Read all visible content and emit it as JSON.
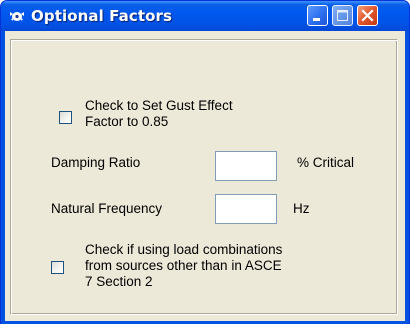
{
  "window": {
    "title": "Optional Factors",
    "icon": "app-icon",
    "controls": {
      "minimize": "minimize-icon",
      "maximize": "maximize-icon",
      "close": "close-icon"
    }
  },
  "form": {
    "gust_checkbox": {
      "label_line1": "Check to Set Gust Effect",
      "label_line2": "Factor to 0.85",
      "checked": false
    },
    "damping": {
      "label": "Damping Ratio",
      "value": "",
      "unit": "% Critical"
    },
    "frequency": {
      "label": "Natural Frequency",
      "value": "",
      "unit": "Hz"
    },
    "load_checkbox": {
      "label_line1": "Check if using load combinations",
      "label_line2": "from sources other than in ASCE",
      "label_line3": "7 Section 2",
      "checked": false
    }
  },
  "colors": {
    "titlebar": "#0058ee",
    "client": "#ece9d8",
    "close_button": "#e2552d"
  }
}
